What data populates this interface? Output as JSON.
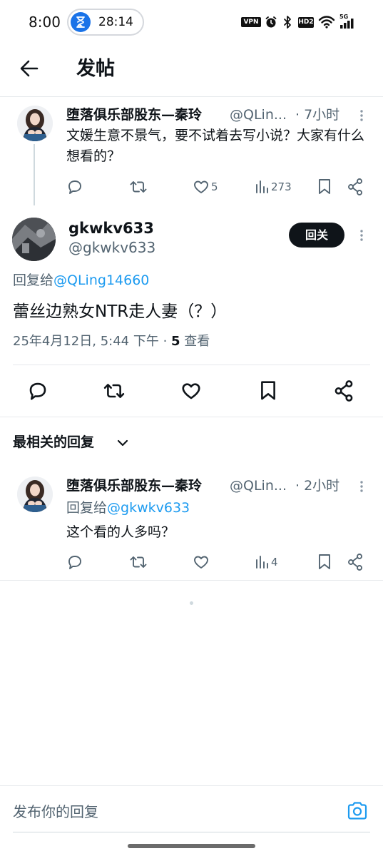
{
  "status_bar": {
    "time": "8:00",
    "timer": "28:14",
    "vpn": "VPN",
    "hd": "HD2",
    "network": "5G",
    "icons": [
      "hourglass-icon",
      "alarm-icon",
      "bluetooth-icon",
      "wifi-icon",
      "signal-icon"
    ]
  },
  "header": {
    "title": "发帖",
    "back_icon": "back-arrow-icon"
  },
  "parent_tweet": {
    "name": "堕落俱乐部股东—秦玲",
    "handle": "@QLin...",
    "time": "· 7小时",
    "text": "文媛生意不景气，要不试着去写小说？大家有什么想看的？",
    "likes": "5",
    "views": "273"
  },
  "main_tweet": {
    "name": "gkwkv633",
    "handle": "@gkwkv633",
    "follow_label": "回关",
    "reply_prefix": "回复给",
    "reply_to": "@QLing14660",
    "text": "蕾丝边熟女NTR走人妻（？）",
    "datetime": "25年4月12日, 5:44 下午 · ",
    "view_count": "5",
    "view_label": " 查看"
  },
  "replies_header": {
    "label": "最相关的回复"
  },
  "reply_tweet": {
    "name": "堕落俱乐部股东—秦玲",
    "handle": "@QLin...",
    "time": "· 2小时",
    "reply_prefix": "回复给",
    "reply_to": "@gkwkv633",
    "text": "这个看的人多吗？",
    "views": "4"
  },
  "composer": {
    "placeholder": "发布你的回复"
  },
  "colors": {
    "link": "#1d9bf0",
    "muted": "#536471",
    "text": "#0f1419"
  }
}
